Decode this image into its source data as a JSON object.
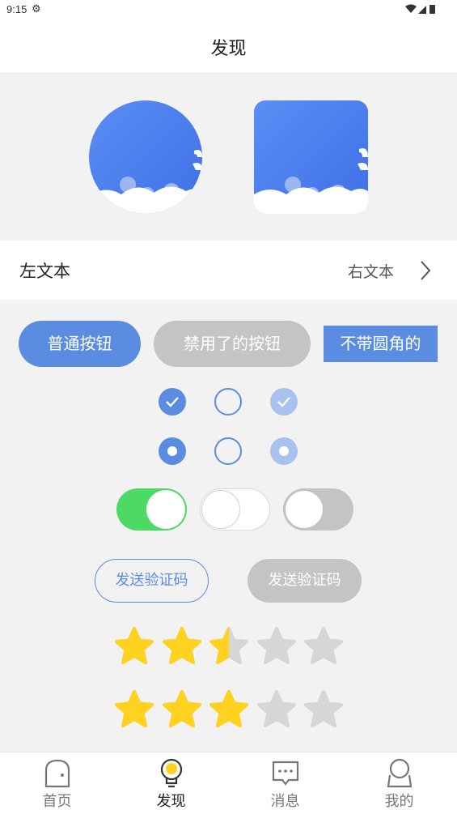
{
  "status_bar": {
    "time": "9:15"
  },
  "header": {
    "title": "发现"
  },
  "list_row": {
    "left_text": "左文本",
    "right_text": "右文本"
  },
  "buttons": {
    "normal": "普通按钮",
    "disabled": "禁用了的按钮",
    "square": "不带圆角的"
  },
  "checkboxes": [
    {
      "state": "checked",
      "enabled": true
    },
    {
      "state": "unchecked",
      "enabled": true
    },
    {
      "state": "checked",
      "enabled": false
    }
  ],
  "radios": [
    {
      "state": "selected",
      "enabled": true
    },
    {
      "state": "unselected",
      "enabled": true
    },
    {
      "state": "selected",
      "enabled": false
    }
  ],
  "switches": [
    {
      "on": true,
      "enabled": true
    },
    {
      "on": false,
      "enabled": true
    },
    {
      "on": false,
      "enabled": false
    }
  ],
  "verify_code": {
    "active_label": "发送验证码",
    "inactive_label": "发送验证码"
  },
  "ratings": [
    {
      "value": 2.5,
      "max": 5
    },
    {
      "value": 3,
      "max": 5
    }
  ],
  "colors": {
    "accent": "#5a8de2",
    "disabled": "#c4c4c4",
    "switch_on": "#4cd964",
    "star_on": "#ffd21f",
    "star_off": "#d6d6d6"
  },
  "tabs": [
    {
      "label": "首页",
      "icon": "home-icon",
      "active": false
    },
    {
      "label": "发现",
      "icon": "lightbulb-icon",
      "active": true
    },
    {
      "label": "消息",
      "icon": "message-icon",
      "active": false
    },
    {
      "label": "我的",
      "icon": "profile-icon",
      "active": false
    }
  ]
}
